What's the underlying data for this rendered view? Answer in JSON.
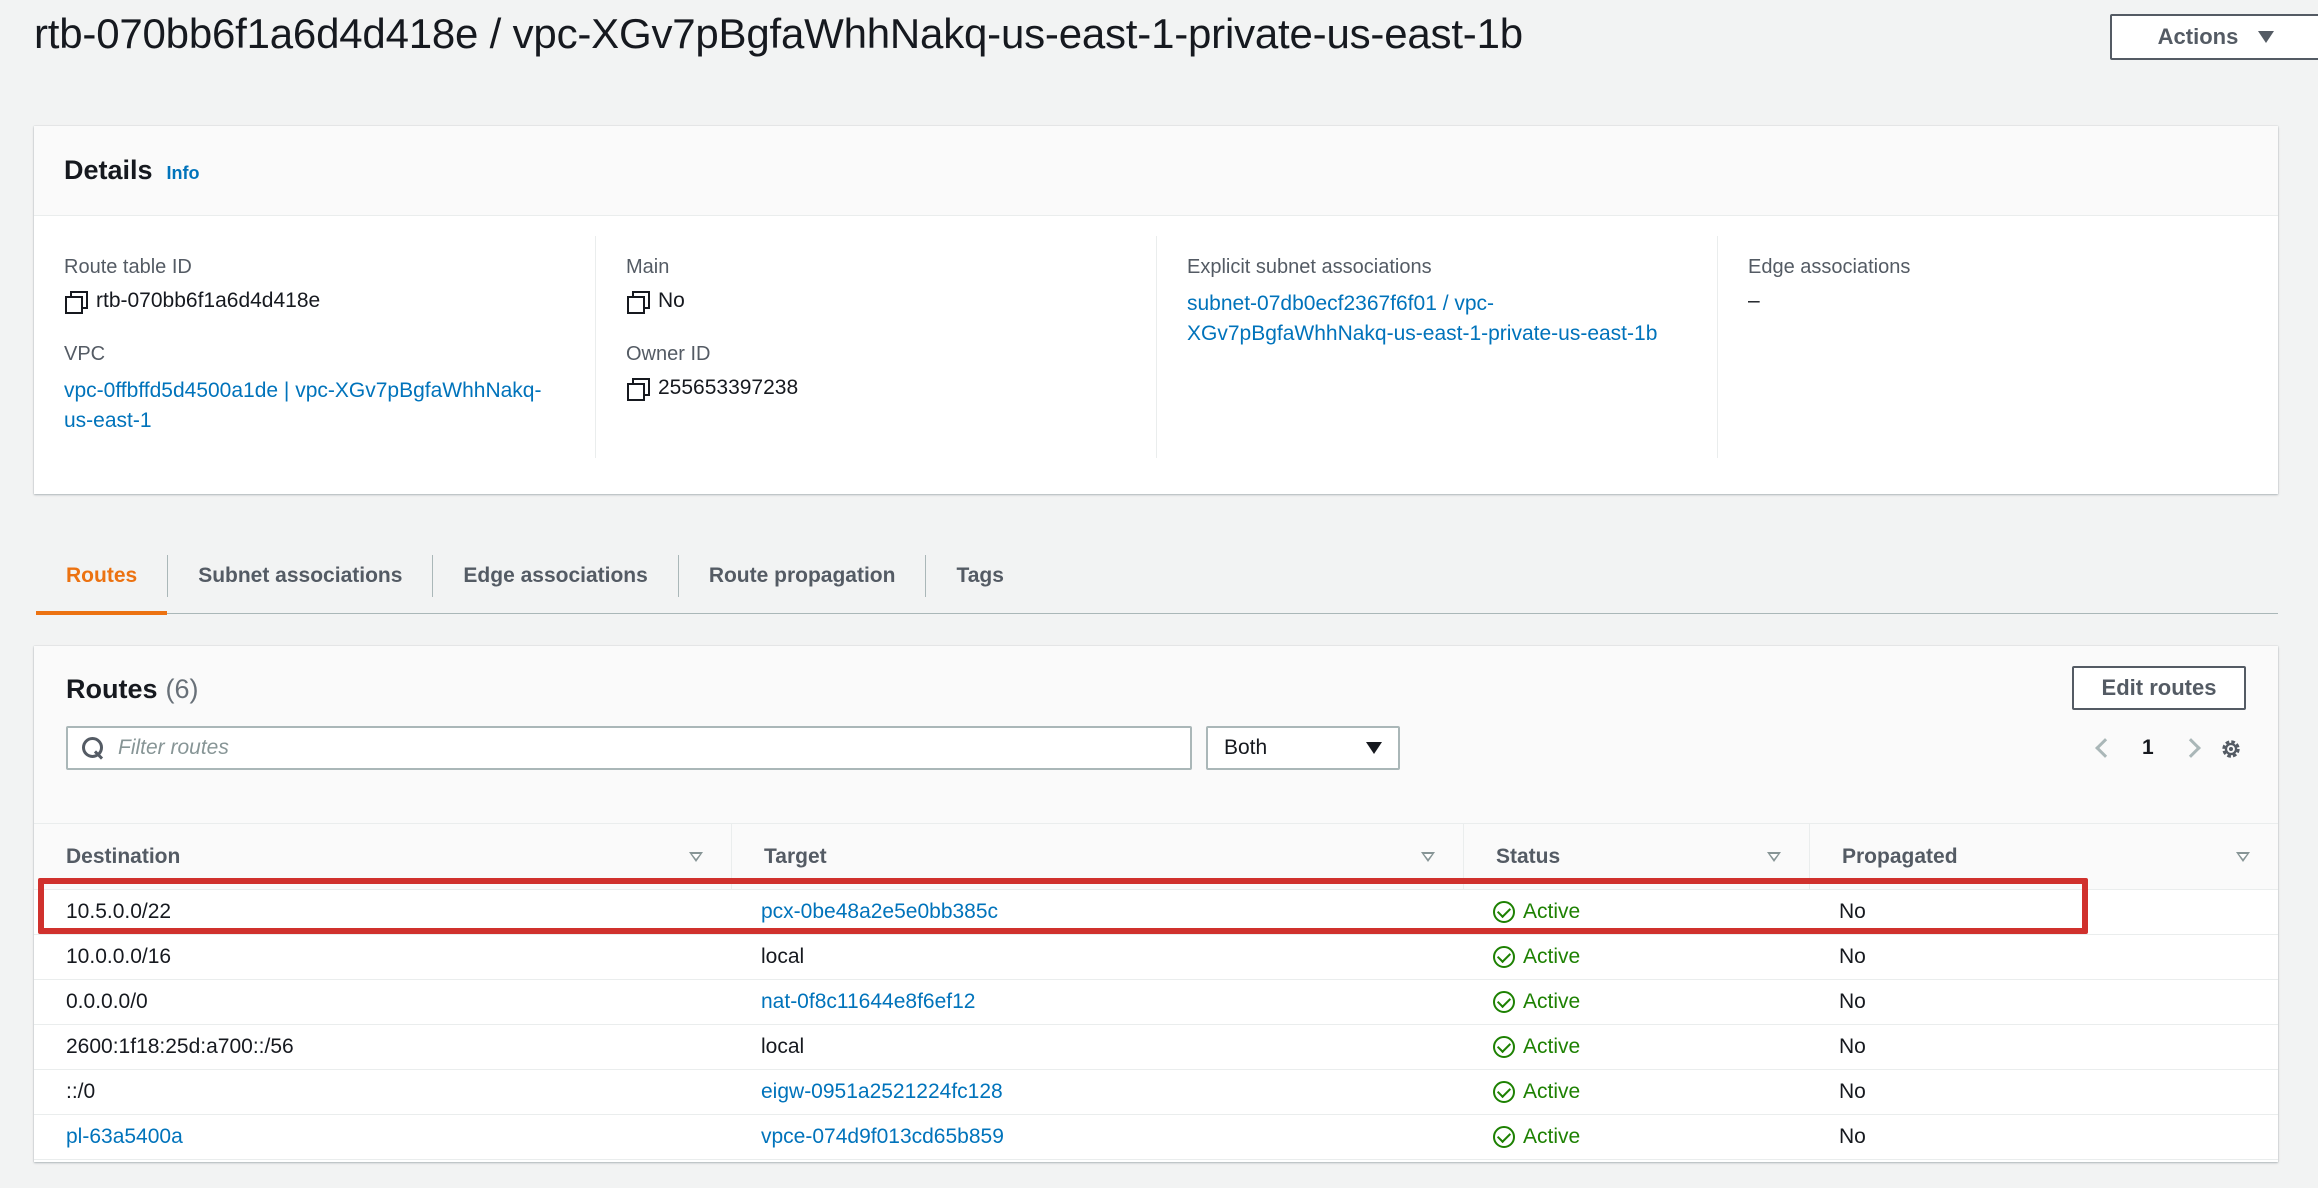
{
  "page": {
    "title": "rtb-070bb6f1a6d4d418e / vpc-XGv7pBgfaWhhNakq-us-east-1-private-us-east-1b",
    "actions_label": "Actions"
  },
  "details": {
    "title": "Details",
    "info_label": "Info",
    "route_table_id": {
      "label": "Route table ID",
      "value": "rtb-070bb6f1a6d4d418e"
    },
    "vpc": {
      "label": "VPC",
      "value": "vpc-0ffbffd5d4500a1de | vpc-XGv7pBgfaWhhNakq-us-east-1"
    },
    "main": {
      "label": "Main",
      "value": "No"
    },
    "owner_id": {
      "label": "Owner ID",
      "value": "255653397238"
    },
    "explicit_subnet": {
      "label": "Explicit subnet associations",
      "value": "subnet-07db0ecf2367f6f01 / vpc-XGv7pBgfaWhhNakq-us-east-1-private-us-east-1b"
    },
    "edge": {
      "label": "Edge associations",
      "value": "–"
    }
  },
  "tabs": [
    {
      "label": "Routes",
      "active": true
    },
    {
      "label": "Subnet associations",
      "active": false
    },
    {
      "label": "Edge associations",
      "active": false
    },
    {
      "label": "Route propagation",
      "active": false
    },
    {
      "label": "Tags",
      "active": false
    }
  ],
  "routes": {
    "title": "Routes",
    "count": "(6)",
    "edit_label": "Edit routes",
    "filter_placeholder": "Filter routes",
    "filter_select": "Both",
    "page_number": "1",
    "columns": [
      "Destination",
      "Target",
      "Status",
      "Propagated"
    ],
    "rows": [
      {
        "destination": "10.5.0.0/22",
        "destination_link": false,
        "target": "pcx-0be48a2e5e0bb385c",
        "target_link": true,
        "status": "Active",
        "propagated": "No"
      },
      {
        "destination": "10.0.0.0/16",
        "destination_link": false,
        "target": "local",
        "target_link": false,
        "status": "Active",
        "propagated": "No"
      },
      {
        "destination": "0.0.0.0/0",
        "destination_link": false,
        "target": "nat-0f8c11644e8f6ef12",
        "target_link": true,
        "status": "Active",
        "propagated": "No"
      },
      {
        "destination": "2600:1f18:25d:a700::/56",
        "destination_link": false,
        "target": "local",
        "target_link": false,
        "status": "Active",
        "propagated": "No"
      },
      {
        "destination": "::/0",
        "destination_link": false,
        "target": "eigw-0951a2521224fc128",
        "target_link": true,
        "status": "Active",
        "propagated": "No"
      },
      {
        "destination": "pl-63a5400a",
        "destination_link": true,
        "target": "vpce-074d9f013cd65b859",
        "target_link": true,
        "status": "Active",
        "propagated": "No"
      }
    ]
  },
  "colors": {
    "link": "#0073bb",
    "active_tab": "#ec7211",
    "status_active": "#1d8102",
    "highlight": "#d0312d"
  },
  "icons": [
    "copy-icon",
    "search-icon",
    "chevron-left-icon",
    "chevron-right-icon",
    "gear-icon",
    "status-check-icon",
    "sort-icon",
    "caret-down-icon"
  ]
}
